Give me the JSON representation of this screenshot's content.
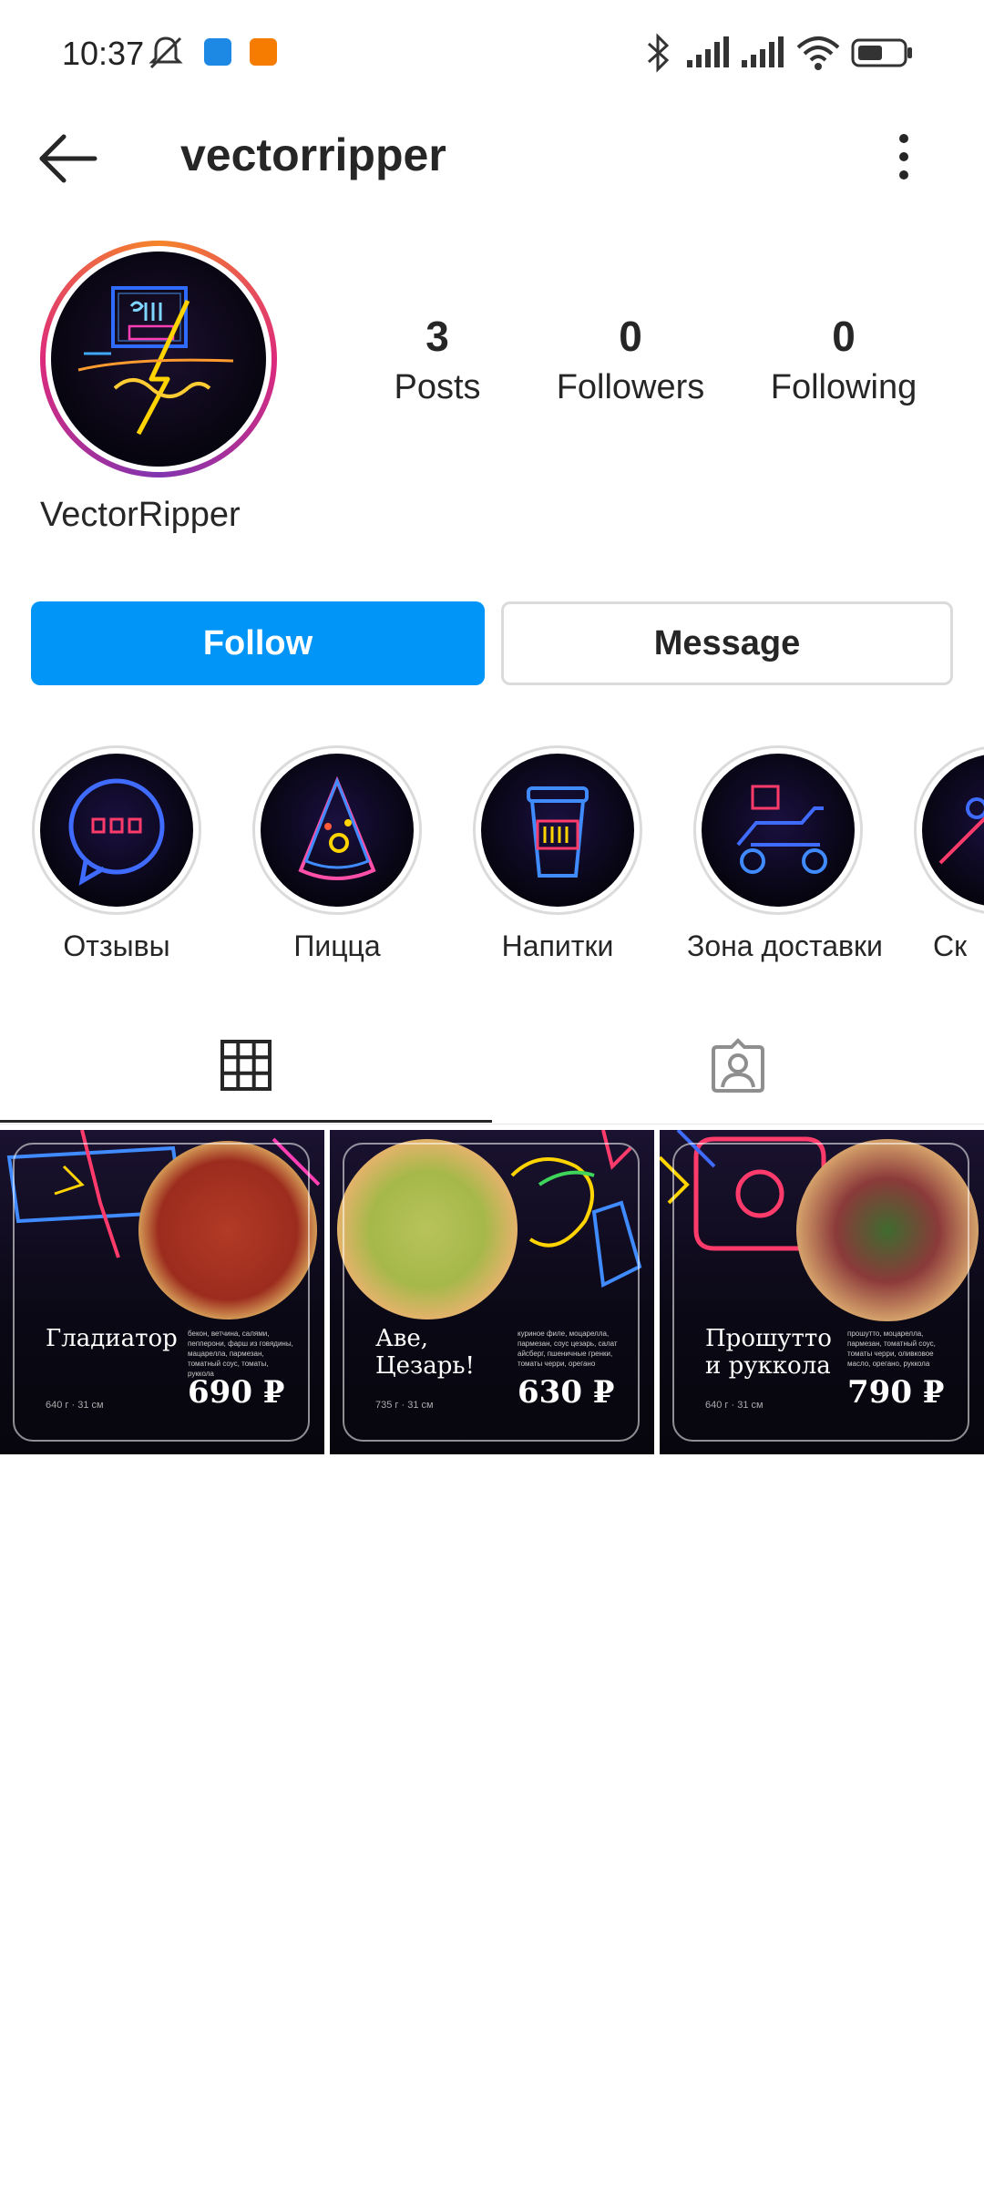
{
  "status_bar": {
    "time": "10:37"
  },
  "header": {
    "username": "vectorripper"
  },
  "profile": {
    "display_name": "VectorRipper",
    "stats": {
      "posts": {
        "value": "3",
        "label": "Posts"
      },
      "followers": {
        "value": "0",
        "label": "Followers"
      },
      "following": {
        "value": "0",
        "label": "Following"
      }
    }
  },
  "buttons": {
    "follow": "Follow",
    "message": "Message"
  },
  "highlights": [
    {
      "label": "Отзывы",
      "icon": "chat-bubble-icon"
    },
    {
      "label": "Пицца",
      "icon": "pizza-slice-icon"
    },
    {
      "label": "Напитки",
      "icon": "drink-cup-icon"
    },
    {
      "label": "Зона доставки",
      "icon": "scooter-icon"
    },
    {
      "label": "Ск",
      "icon": "neon-icon"
    }
  ],
  "tabs": [
    {
      "name": "grid",
      "icon": "grid-icon"
    },
    {
      "name": "tagged",
      "icon": "tagged-person-icon"
    }
  ],
  "posts": [
    {
      "title": "Гладиатор",
      "price": "690 ₽",
      "weight": "640 г",
      "size": "31 см",
      "desc": "бекон, ветчина, салями, пепперони, фарш из говядины, мацарелла, пармезан, томатный соус, томаты, руккола"
    },
    {
      "title": "Аве,\nЦезарь!",
      "price": "630 ₽",
      "weight": "735 г",
      "size": "31 см",
      "desc": "куриное филе, моцарелла, пармезан, соус цезарь, салат айсберг, пшеничные гренки, томаты черри, орегано"
    },
    {
      "title": "Прошутто\nи руккола",
      "price": "790 ₽",
      "weight": "640 г",
      "size": "31 см",
      "desc": "прошутто, моцарелла, пармезан, томатный соус, томаты черри, оливковое масло, орегано, руккола"
    }
  ],
  "colors": {
    "accent": "#0095f6",
    "text": "#262626",
    "border": "#dbdbdb"
  }
}
